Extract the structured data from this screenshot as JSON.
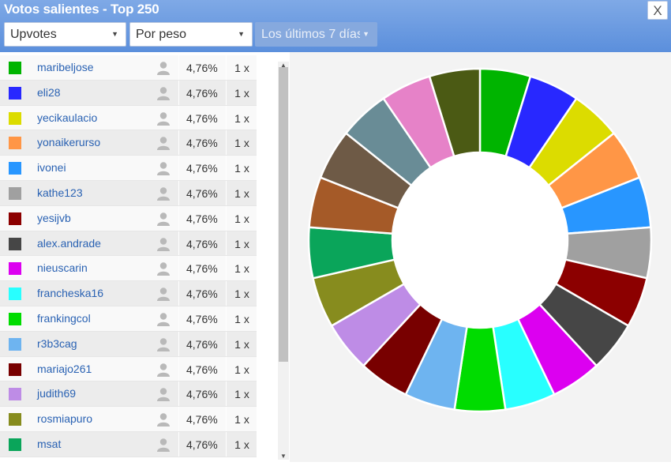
{
  "title": "Votos salientes - Top 250",
  "close_label": "X",
  "filters": {
    "type": "Upvotes",
    "weight": "Por peso",
    "period": "Los últimos 7 días"
  },
  "colors": {
    "header": "#6b9ae0",
    "link": "#2a62b3"
  },
  "rows": [
    {
      "name": "maribeljose",
      "pct": "4,76%",
      "count": "1 x",
      "color": "#00b400"
    },
    {
      "name": "eli28",
      "pct": "4,76%",
      "count": "1 x",
      "color": "#2828ff"
    },
    {
      "name": "yecikaulacio",
      "pct": "4,76%",
      "count": "1 x",
      "color": "#dcdc00"
    },
    {
      "name": "yonaikerurso",
      "pct": "4,76%",
      "count": "1 x",
      "color": "#ff9646"
    },
    {
      "name": "ivonei",
      "pct": "4,76%",
      "count": "1 x",
      "color": "#2896ff"
    },
    {
      "name": "kathe123",
      "pct": "4,76%",
      "count": "1 x",
      "color": "#a0a0a0"
    },
    {
      "name": "yesijvb",
      "pct": "4,76%",
      "count": "1 x",
      "color": "#8c0000"
    },
    {
      "name": "alex.andrade",
      "pct": "4,76%",
      "count": "1 x",
      "color": "#464646"
    },
    {
      "name": "nieuscarin",
      "pct": "4,76%",
      "count": "1 x",
      "color": "#dc00f0"
    },
    {
      "name": "francheska16",
      "pct": "4,76%",
      "count": "1 x",
      "color": "#28ffff"
    },
    {
      "name": "frankingcol",
      "pct": "4,76%",
      "count": "1 x",
      "color": "#00dc00"
    },
    {
      "name": "r3b3cag",
      "pct": "4,76%",
      "count": "1 x",
      "color": "#6eb4f0"
    },
    {
      "name": "mariajo261",
      "pct": "4,76%",
      "count": "1 x",
      "color": "#780000"
    },
    {
      "name": "judith69",
      "pct": "4,76%",
      "count": "1 x",
      "color": "#be8ce6"
    },
    {
      "name": "rosmiapuro",
      "pct": "4,76%",
      "count": "1 x",
      "color": "#878c1e"
    },
    {
      "name": "msat",
      "pct": "4,76%",
      "count": "1 x",
      "color": "#0aa55a"
    }
  ],
  "chart_data": {
    "type": "pie",
    "values": [
      4.76,
      4.76,
      4.76,
      4.76,
      4.76,
      4.76,
      4.76,
      4.76,
      4.76,
      4.76,
      4.76,
      4.76,
      4.76,
      4.76,
      4.76,
      4.76,
      4.76,
      4.76,
      4.76,
      4.76,
      4.76
    ],
    "colors": [
      "#00b400",
      "#2828ff",
      "#dcdc00",
      "#ff9646",
      "#2896ff",
      "#a0a0a0",
      "#8c0000",
      "#464646",
      "#dc00f0",
      "#28ffff",
      "#00dc00",
      "#6eb4f0",
      "#780000",
      "#be8ce6",
      "#878c1e",
      "#0aa55a",
      "#a55a28",
      "#6e5a46",
      "#698c96",
      "#e682c8",
      "#4b5a14"
    ],
    "donut": true
  }
}
